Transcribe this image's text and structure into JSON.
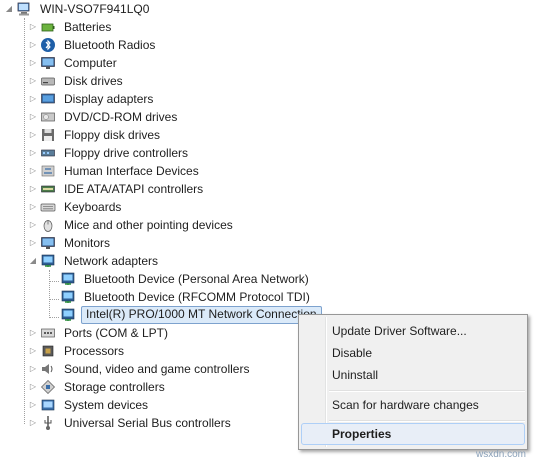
{
  "computer": {
    "name": "WIN-VSO7F941LQ0",
    "icon": "computer-icon"
  },
  "categories": [
    {
      "label": "Batteries",
      "icon": "battery-icon",
      "expanded": false
    },
    {
      "label": "Bluetooth Radios",
      "icon": "bluetooth-icon",
      "expanded": false
    },
    {
      "label": "Computer",
      "icon": "monitor-icon",
      "expanded": false
    },
    {
      "label": "Disk drives",
      "icon": "disk-drive-icon",
      "expanded": false
    },
    {
      "label": "Display adapters",
      "icon": "display-adapter-icon",
      "expanded": false
    },
    {
      "label": "DVD/CD-ROM drives",
      "icon": "dvd-drive-icon",
      "expanded": false
    },
    {
      "label": "Floppy disk drives",
      "icon": "floppy-icon",
      "expanded": false
    },
    {
      "label": "Floppy drive controllers",
      "icon": "controller-icon",
      "expanded": false
    },
    {
      "label": "Human Interface Devices",
      "icon": "hid-icon",
      "expanded": false
    },
    {
      "label": "IDE ATA/ATAPI controllers",
      "icon": "ide-controller-icon",
      "expanded": false
    },
    {
      "label": "Keyboards",
      "icon": "keyboard-icon",
      "expanded": false
    },
    {
      "label": "Mice and other pointing devices",
      "icon": "mouse-icon",
      "expanded": false
    },
    {
      "label": "Monitors",
      "icon": "monitor-icon",
      "expanded": false
    },
    {
      "label": "Network adapters",
      "icon": "network-adapter-icon",
      "expanded": true
    },
    {
      "label": "Ports (COM & LPT)",
      "icon": "port-icon",
      "expanded": false
    },
    {
      "label": "Processors",
      "icon": "processor-icon",
      "expanded": false
    },
    {
      "label": "Sound, video and game controllers",
      "icon": "speaker-icon",
      "expanded": false
    },
    {
      "label": "Storage controllers",
      "icon": "storage-controller-icon",
      "expanded": false
    },
    {
      "label": "System devices",
      "icon": "system-device-icon",
      "expanded": false
    },
    {
      "label": "Universal Serial Bus controllers",
      "icon": "usb-icon",
      "expanded": false
    }
  ],
  "network_adapters": [
    {
      "label": "Bluetooth Device (Personal Area Network)",
      "icon": "network-adapter-icon",
      "selected": false
    },
    {
      "label": "Bluetooth Device (RFCOMM Protocol TDI)",
      "icon": "network-adapter-icon",
      "selected": false
    },
    {
      "label": "Intel(R) PRO/1000 MT Network Connection",
      "icon": "network-adapter-icon",
      "selected": true
    }
  ],
  "context_menu": {
    "update_driver": "Update Driver Software...",
    "disable": "Disable",
    "uninstall": "Uninstall",
    "scan": "Scan for hardware changes",
    "properties": "Properties"
  },
  "watermark": "wsxdn.com",
  "colors": {
    "selection_bg": "#dbeaf9",
    "selection_border": "#7da2ce",
    "menu_bg": "#f0f0f0",
    "menu_hover_bg": "#e8eef7"
  }
}
